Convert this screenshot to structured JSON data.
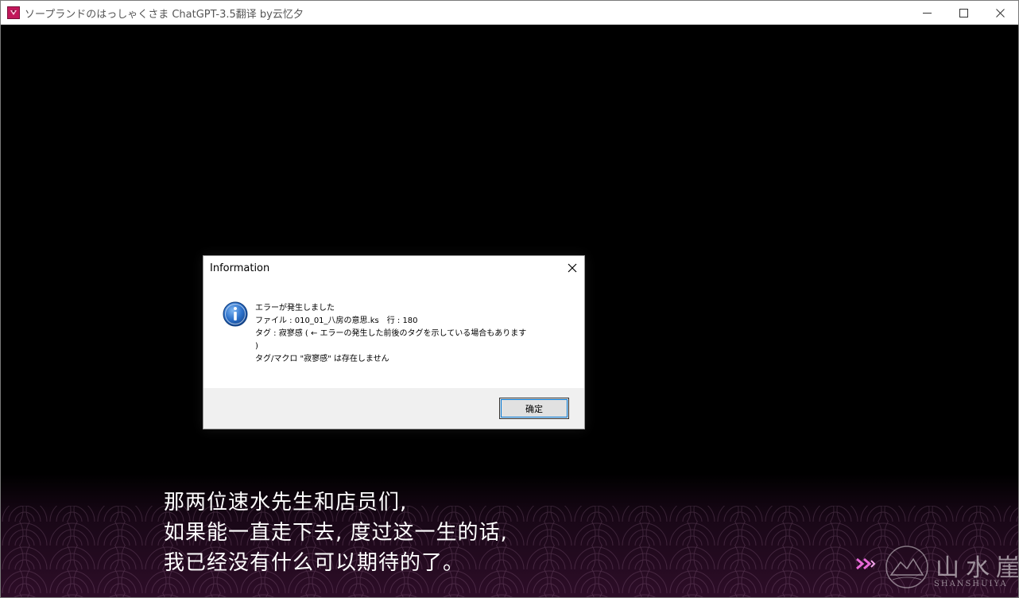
{
  "window": {
    "title": "ソープランドのはっしゃくさま ChatGPT-3.5翻译 by云忆夕",
    "icon": "app-icon"
  },
  "window_controls": {
    "minimize": "minimize-icon",
    "maximize": "maximize-icon",
    "close": "close-icon"
  },
  "dialog": {
    "title": "Information",
    "icon": "info-icon",
    "lines": [
      "エラーが発生しました",
      "ファイル : 010_01_八房の意思.ks　行 : 180",
      "タグ : 寂寥感 ( ← エラーの発生した前後のタグを示している場合もあります",
      ")",
      "タグ/マクロ \"寂寥感\" は存在しません"
    ],
    "ok_label": "确定"
  },
  "game": {
    "dialogue": [
      "那两位速水先生和店员们,",
      "如果能一直走下去, 度过这一生的话,",
      "我已经没有什么可以期待的了。"
    ],
    "next_indicator": "double-chevron-right-icon",
    "watermark": {
      "chars": "山水崖",
      "latin": "SHANSHUIYA"
    }
  },
  "colors": {
    "panel_accent": "#300e2a",
    "arrow": "#e86ad8",
    "button_focus": "#0078d7"
  }
}
